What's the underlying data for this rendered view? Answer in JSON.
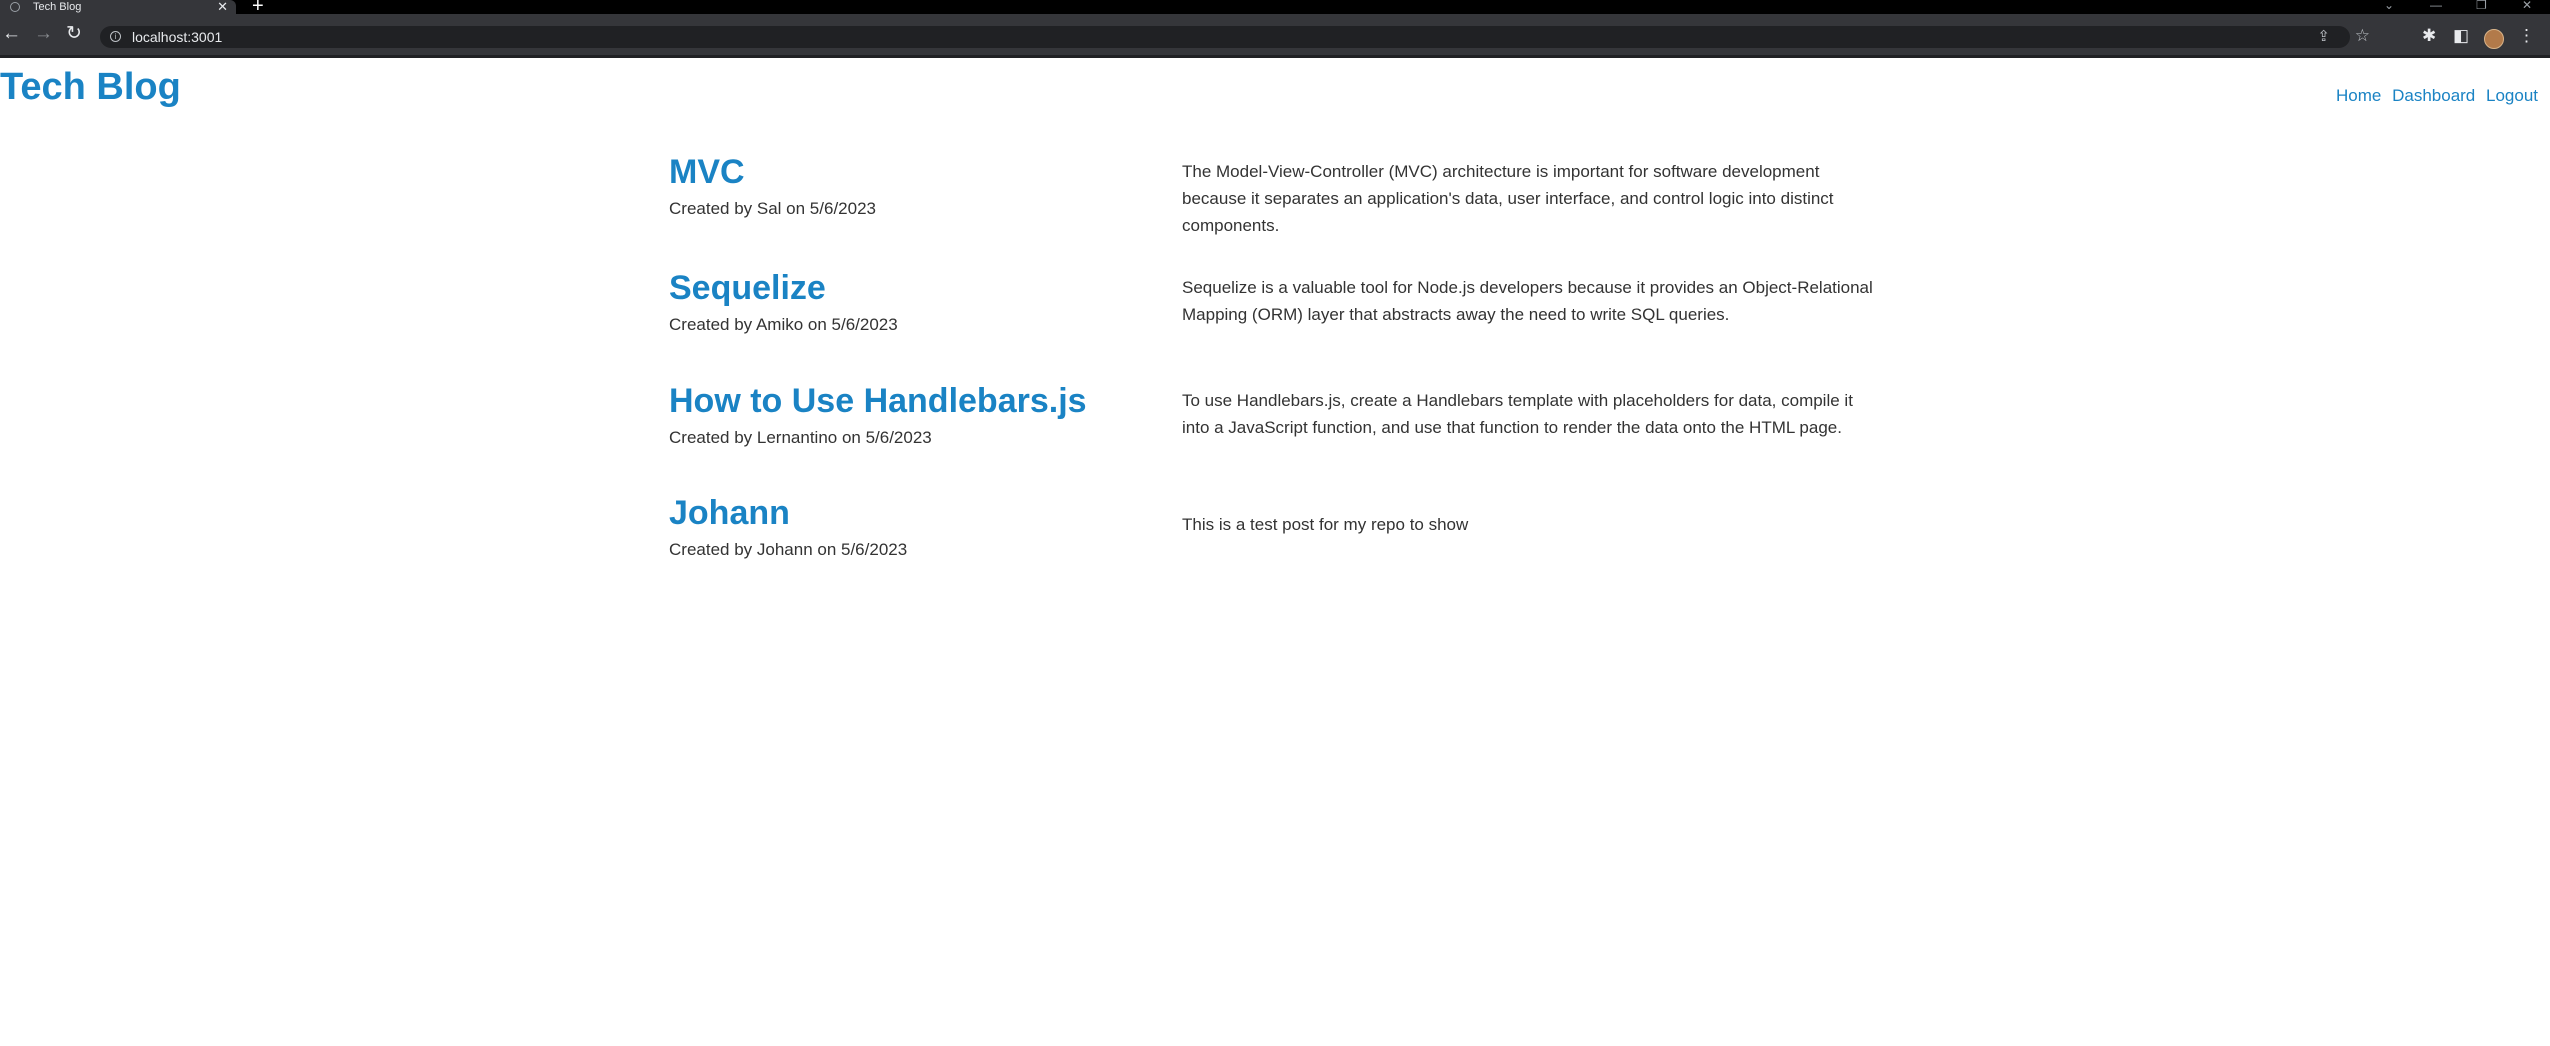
{
  "browser": {
    "tab_title": "Tech Blog",
    "tab_close": "✕",
    "new_tab": "+",
    "url": "localhost:3001",
    "icons": [
      "globe-icon",
      "back-icon",
      "forward-icon",
      "reload-icon",
      "info-icon",
      "share-icon",
      "star-icon",
      "extensions-icon",
      "sidepanel-icon",
      "profile-avatar",
      "menu-icon"
    ]
  },
  "site": {
    "title": "Tech Blog",
    "nav": [
      "Home",
      "Dashboard",
      "Logout"
    ],
    "brand_color": "#1a83c4"
  },
  "posts": [
    {
      "title": "MVC",
      "byline": "Created by Sal on 5/6/2023",
      "content": "The Model-View-Controller (MVC) architecture is important for software development because it separates an application's data, user interface, and control logic into distinct components."
    },
    {
      "title": "Sequelize",
      "byline": "Created by Amiko on 5/6/2023",
      "content": "Sequelize is a valuable tool for Node.js developers because it provides an Object-Relational Mapping (ORM) layer that abstracts away the need to write SQL queries."
    },
    {
      "title": "How to Use Handlebars.js",
      "byline": "Created by Lernantino on 5/6/2023",
      "content": "To use Handlebars.js, create a Handlebars template with placeholders for data, compile it into a JavaScript function, and use that function to render the data onto the HTML page."
    },
    {
      "title": "Johann",
      "byline": "Created by Johann on 5/6/2023",
      "content": "This is a test post for my repo to show"
    }
  ]
}
